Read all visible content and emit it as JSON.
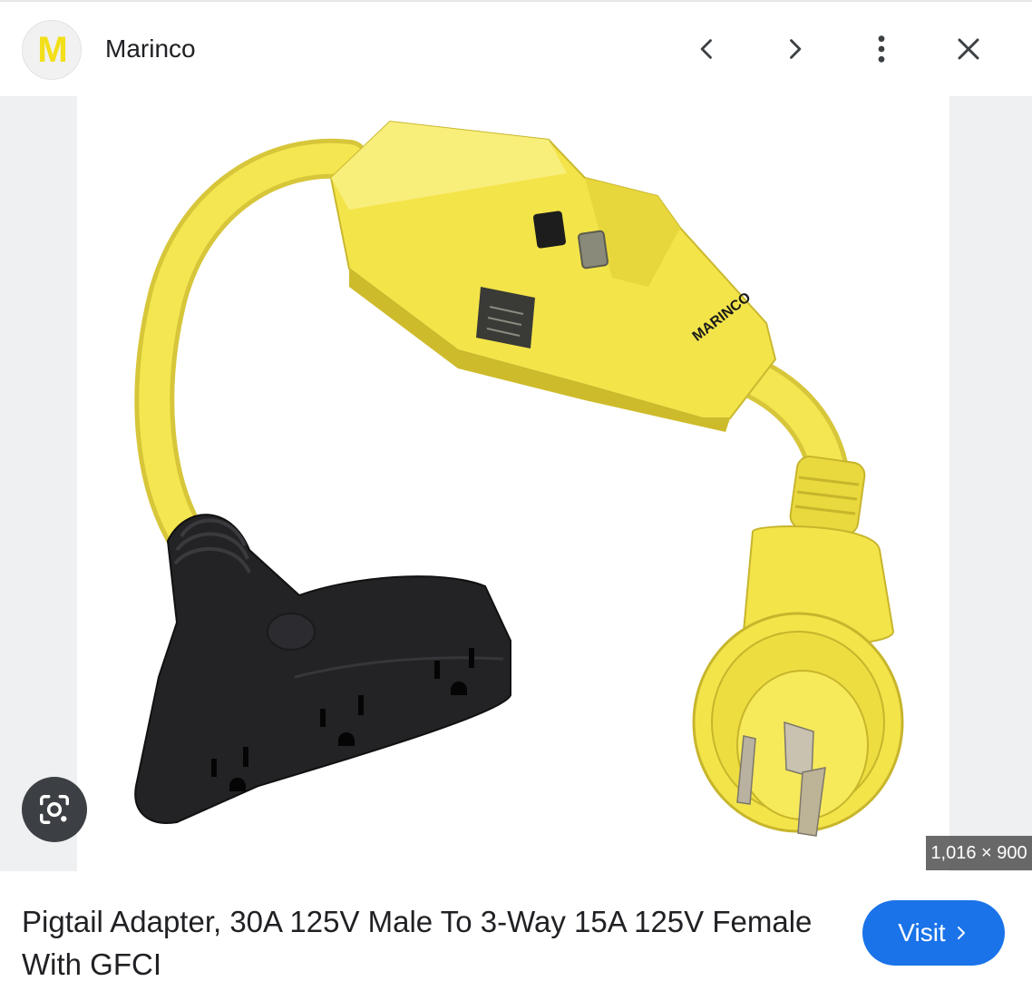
{
  "header": {
    "logo_letter": "M",
    "site_name": "Marinco",
    "buttons": {
      "prev_icon": "chevron-left-icon",
      "next_icon": "chevron-right-icon",
      "more_icon": "more-vert-icon",
      "close_icon": "close-icon"
    }
  },
  "image": {
    "brand_text": "MARINCO",
    "dimensions": "1,016 × 900",
    "lens_icon": "google-lens-icon"
  },
  "result": {
    "title": "Pigtail Adapter, 30A 125V Male To 3-Way 15A 125V Female With GFCI",
    "visit_label": "Visit",
    "visit_icon": "chevron-right-icon"
  },
  "colors": {
    "accent_blue": "#1a73e8",
    "product_yellow": "#f3e44a",
    "product_black": "#1f1f22"
  }
}
